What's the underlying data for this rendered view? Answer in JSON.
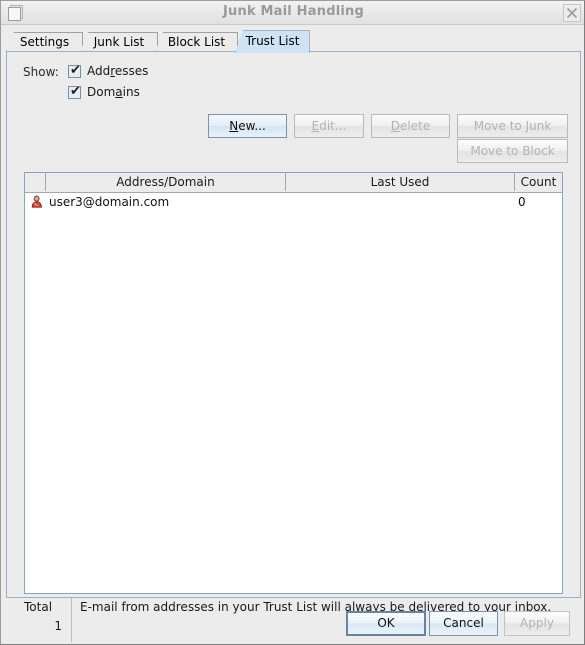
{
  "window": {
    "title": "Junk Mail Handling",
    "icon": "document-icon",
    "close_icon": "close-icon"
  },
  "tabs": [
    {
      "label": "Settings",
      "selected": false
    },
    {
      "label": "Junk List",
      "selected": false
    },
    {
      "label": "Block List",
      "selected": false
    },
    {
      "label": "Trust List",
      "selected": true
    }
  ],
  "show": {
    "label": "Show:",
    "options": [
      {
        "label_pre": "Add",
        "label_mn": "r",
        "label_post": "esses",
        "checked": true,
        "check_glyph": "✔"
      },
      {
        "label_pre": "Dom",
        "label_mn": "a",
        "label_post": "ins",
        "checked": true,
        "check_glyph": "✔"
      }
    ]
  },
  "actions": {
    "new": {
      "label_pre": "",
      "label_mn": "N",
      "label_post": "ew...",
      "enabled": true
    },
    "edit": {
      "label_pre": "",
      "label_mn": "E",
      "label_post": "dit...",
      "enabled": false
    },
    "delete": {
      "label_pre": "",
      "label_mn": "D",
      "label_post": "elete",
      "enabled": false
    },
    "move_to_junk": {
      "label": "Move to Junk",
      "enabled": false
    },
    "move_to_block": {
      "label": "Move to Block",
      "enabled": false
    }
  },
  "list": {
    "columns": [
      "",
      "Address/Domain",
      "Last Used",
      "Count"
    ],
    "rows": [
      {
        "icon": "contact-icon",
        "address": "user3@domain.com",
        "last_used": "",
        "count": "0"
      }
    ]
  },
  "footer": {
    "total_label": "Total",
    "total_value": "1",
    "description": "E-mail from addresses in your Trust List will always be delivered to your inbox."
  },
  "dialog_buttons": {
    "ok": {
      "label": "OK",
      "enabled": true,
      "default": true
    },
    "cancel": {
      "label": "Cancel",
      "enabled": true,
      "default": false
    },
    "apply": {
      "label": "Apply",
      "enabled": false,
      "default": false
    }
  },
  "colors": {
    "dialog_bg": "#ececec",
    "selected_tab": "#cfe3f5",
    "panel_border": "#9cb0c6",
    "list_bg": "#ffffff",
    "title_text": "#9a9a9a"
  }
}
